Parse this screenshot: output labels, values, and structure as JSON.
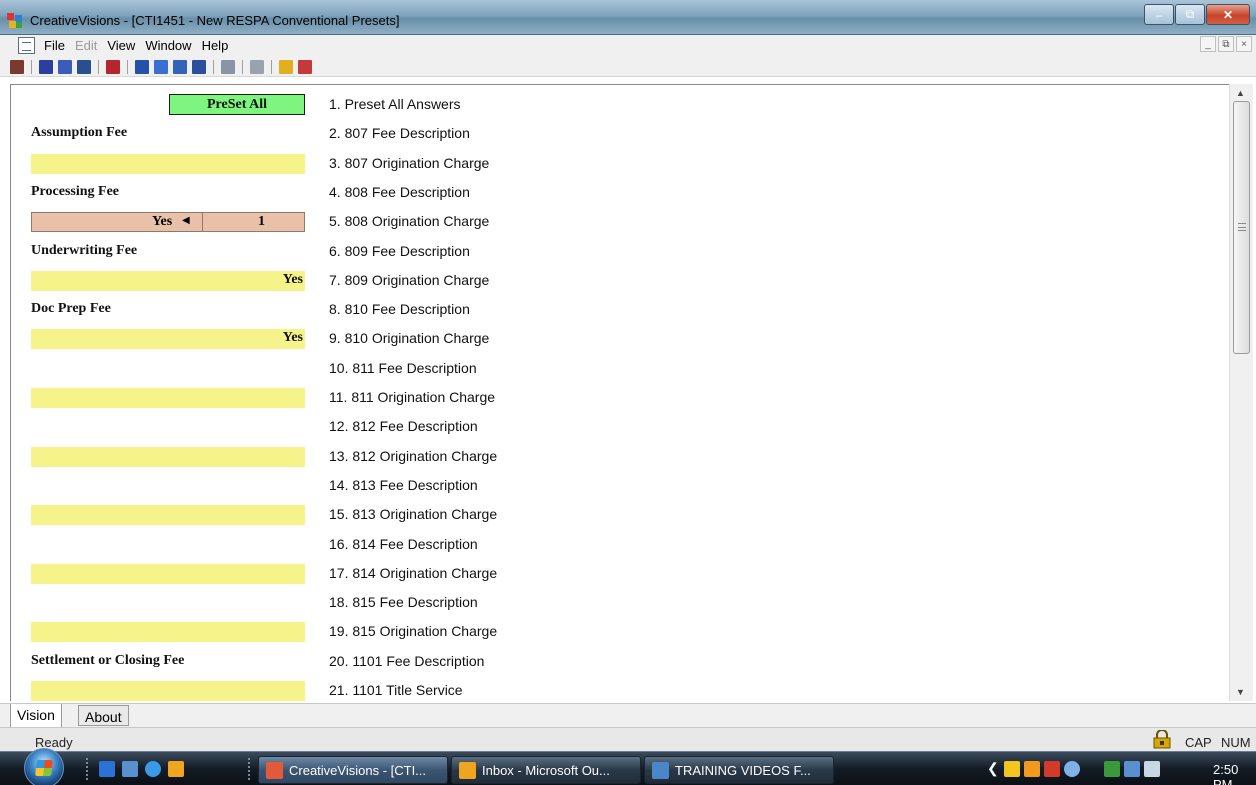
{
  "window": {
    "title": "CreativeVisions - [CTI1451 - New RESPA Conventional Presets]",
    "controls": {
      "minimize": "–",
      "restore": "⧉",
      "close": "✕"
    }
  },
  "menubar": {
    "items": [
      {
        "label": "File",
        "enabled": true
      },
      {
        "label": "Edit",
        "enabled": false
      },
      {
        "label": "View",
        "enabled": true
      },
      {
        "label": "Window",
        "enabled": true
      },
      {
        "label": "Help",
        "enabled": true
      }
    ],
    "mdi_controls": [
      "_",
      "⧉",
      "×"
    ]
  },
  "toolbar": {
    "icons": [
      "book-icon",
      "form-d-icon",
      "form-d2-icon",
      "chart-icon",
      "bookmark-icon",
      "person-icon",
      "refresh-icon",
      "calculator-icon",
      "grid-icon",
      "pin-icon",
      "print-icon",
      "help-icon",
      "eraser-icon"
    ]
  },
  "colors": {
    "yellow_field": "#f7f38b",
    "green_button": "#7ef57e",
    "peach_field": "#e8c1a8"
  },
  "content": {
    "preset_all_button": "PreSet All",
    "rows": [
      {
        "kind": "button",
        "question": "1. Preset All Answers"
      },
      {
        "kind": "label",
        "label": "Assumption Fee",
        "question": "2. 807 Fee Description"
      },
      {
        "kind": "field",
        "value": "",
        "question": "3. 807 Origination Charge"
      },
      {
        "kind": "label",
        "label": "Processing Fee",
        "question": "4. 808 Fee Description"
      },
      {
        "kind": "stepper",
        "value": "Yes",
        "count": "1",
        "question": "5. 808 Origination Charge"
      },
      {
        "kind": "label",
        "label": "Underwriting Fee",
        "question": "6. 809 Fee Description"
      },
      {
        "kind": "field",
        "value": "Yes",
        "question": "7. 809 Origination Charge"
      },
      {
        "kind": "label",
        "label": "Doc Prep Fee",
        "question": "8. 810 Fee Description"
      },
      {
        "kind": "field",
        "value": "Yes",
        "question": "9. 810 Origination Charge"
      },
      {
        "kind": "label",
        "label": "",
        "question": "10. 811 Fee Description"
      },
      {
        "kind": "field",
        "value": "",
        "question": "11. 811 Origination Charge"
      },
      {
        "kind": "label",
        "label": "",
        "question": "12. 812 Fee Description"
      },
      {
        "kind": "field",
        "value": "",
        "question": "13. 812 Origination Charge"
      },
      {
        "kind": "label",
        "label": "",
        "question": "14. 813 Fee Description"
      },
      {
        "kind": "field",
        "value": "",
        "question": "15. 813 Origination Charge"
      },
      {
        "kind": "label",
        "label": "",
        "question": "16. 814 Fee Description"
      },
      {
        "kind": "field",
        "value": "",
        "question": "17. 814 Origination Charge"
      },
      {
        "kind": "label",
        "label": "",
        "question": "18. 815 Fee Description"
      },
      {
        "kind": "field",
        "value": "",
        "question": "19. 815 Origination Charge"
      },
      {
        "kind": "label",
        "label": "Settlement or Closing Fee",
        "question": "20. 1101 Fee Description"
      },
      {
        "kind": "field",
        "value": "",
        "question": "21. 1101 Title Service"
      }
    ]
  },
  "tabs": [
    {
      "label": "Vision",
      "active": true
    },
    {
      "label": "About",
      "active": false
    }
  ],
  "statusbar": {
    "text": "Ready",
    "indicators": [
      "CAP",
      "NUM"
    ]
  },
  "taskbar": {
    "buttons": [
      {
        "label": "CreativeVisions - [CTI...",
        "icon": "creativevisions-icon",
        "active": true
      },
      {
        "label": "Inbox - Microsoft Ou...",
        "icon": "outlook-icon",
        "active": false
      },
      {
        "label": "TRAINING VIDEOS F...",
        "icon": "folder-icon",
        "active": false
      }
    ],
    "clock": "2:50 PM"
  }
}
